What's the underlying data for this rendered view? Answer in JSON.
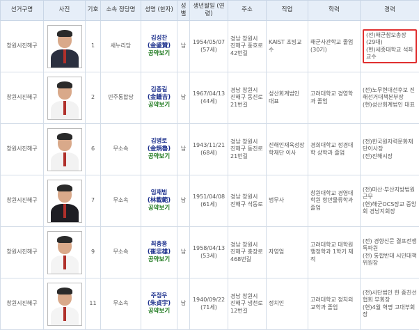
{
  "headers": {
    "district": "선거구명",
    "photo": "사진",
    "number": "기호",
    "party": "소속 정당명",
    "name": "성명 (한자)",
    "gender": "성별",
    "birth": "생년월일 (연령)",
    "address": "주소",
    "job": "직업",
    "education": "학력",
    "career": "경력"
  },
  "candidates": [
    {
      "district": "창원시진해구",
      "number": "1",
      "party": "새누리당",
      "name_ko": "김성찬",
      "name_cn": "(金盛贊)",
      "pledge": "공약보기",
      "gender": "남",
      "birth": "1954/05/07",
      "age": "(57세)",
      "address": "경남 창원시 진해구 풍호로42번길",
      "job": "KAIST 초빙교수",
      "education": "해군사관학교 졸업(30기)",
      "career1": "(전)해군참모총장(29대)",
      "career2": "(현)세종대학교 석좌교수",
      "suit": "#2b3040"
    },
    {
      "district": "창원시진해구",
      "number": "2",
      "party": "민주통합당",
      "name_ko": "김종길",
      "name_cn": "(金鍾吉)",
      "pledge": "공약보기",
      "gender": "남",
      "birth": "1967/04/13",
      "age": "(44세)",
      "address": "경남 창원시 진해구 동진로21번길",
      "job": "성산회계법인 대표",
      "education": "고려대학교 경영학과 졸업",
      "career1": "(전)노무현대선후보 진해선거대책본부장",
      "career2": "(현)성산회계법인 대표",
      "suit": "#f2f2f2"
    },
    {
      "district": "창원시진해구",
      "number": "6",
      "party": "무소속",
      "name_ko": "김병로",
      "name_cn": "(金炳魯)",
      "pledge": "공약보기",
      "gender": "남",
      "birth": "1943/11/21",
      "age": "(68세)",
      "address": "경남 창원시 진해구 동진로21번길",
      "job": "진해인재육성장학재단 이사",
      "education": "경희대학교 정경대학 상학과 졸업",
      "career1": "(전)한국원자력문화재단이사장",
      "career2": "(전)진해시장",
      "suit": "#f2f2f2"
    },
    {
      "district": "창원시진해구",
      "number": "7",
      "party": "무소속",
      "name_ko": "임재범",
      "name_cn": "(林載範)",
      "pledge": "공약보기",
      "gender": "남",
      "birth": "1951/04/08",
      "age": "(61세)",
      "address": "경남 창원시 진해구 석동로",
      "job": "법무사",
      "education": "창원대학교 경영대학원 항만물류학과 졸업",
      "career1": "(전)마산·부산지방법원 근무",
      "career2": "(현)해군OCS장교 중앙회 경남지회장",
      "suit": "#1e1e24"
    },
    {
      "district": "창원시진해구",
      "number": "9",
      "party": "무소속",
      "name_ko": "최충웅",
      "name_cn": "(崔忠雄)",
      "pledge": "공약보기",
      "gender": "남",
      "birth": "1958/04/13",
      "age": "(53세)",
      "address": "경남 창원시 진해구 충장로468번길",
      "job": "자영업",
      "education": "고려대학교 대학원 행정학과 1학기 제적",
      "career1": "(전) 경향신문 결프전쟁 특파원",
      "career2": "(전) 통합반대 시민대책위원장",
      "suit": "#f4f4f4"
    },
    {
      "district": "창원시진해구",
      "number": "11",
      "party": "무소속",
      "name_ko": "주정우",
      "name_cn": "(朱貞宇)",
      "pledge": "공약보기",
      "gender": "남",
      "birth": "1940/09/22",
      "age": "(71세)",
      "address": "경남 창원시 진해구 냉천로12번길",
      "job": "정치인",
      "education": "고려대학교 정치외교학과 졸업",
      "career1": "(전)사단법인 한 중친선협회 부회장",
      "career2": "(현)4월 혁명 고대부회장",
      "suit": "#f4f4f4"
    }
  ]
}
